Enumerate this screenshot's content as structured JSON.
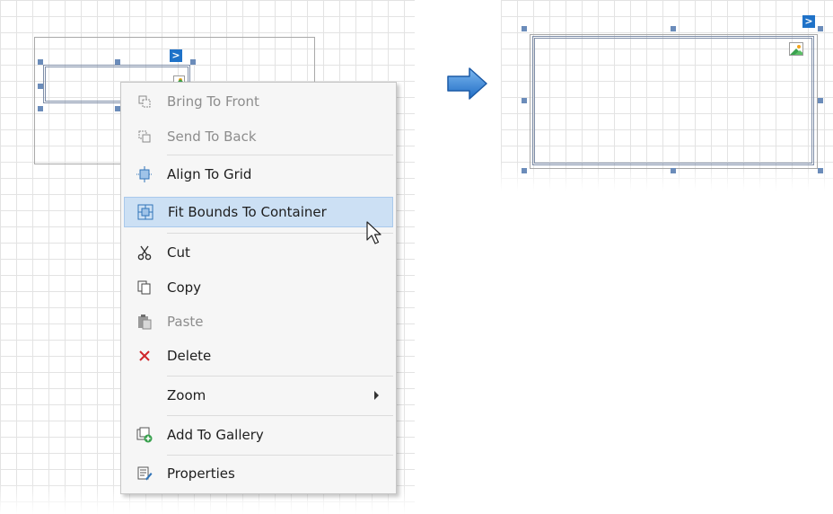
{
  "context_menu": {
    "items": [
      {
        "label": "Bring To Front",
        "icon": "bring-to-front-icon",
        "enabled": false
      },
      {
        "label": "Send To Back",
        "icon": "send-to-back-icon",
        "enabled": false
      },
      {
        "label": "Align To Grid",
        "icon": "align-to-grid-icon",
        "enabled": true
      },
      {
        "label": "Fit Bounds To Container",
        "icon": "fit-bounds-icon",
        "enabled": true,
        "highlighted": true
      },
      {
        "label": "Cut",
        "icon": "scissors-icon",
        "enabled": true
      },
      {
        "label": "Copy",
        "icon": "copy-icon",
        "enabled": true
      },
      {
        "label": "Paste",
        "icon": "paste-icon",
        "enabled": false
      },
      {
        "label": "Delete",
        "icon": "delete-icon",
        "enabled": true
      },
      {
        "label": "Zoom",
        "icon": "",
        "enabled": true,
        "has_submenu": true
      },
      {
        "label": "Add To Gallery",
        "icon": "add-to-gallery-icon",
        "enabled": true
      },
      {
        "label": "Properties",
        "icon": "properties-icon",
        "enabled": true
      }
    ]
  },
  "smart_tag_glyph": ">",
  "colors": {
    "highlight_bg": "#cce0f4",
    "arrow_blue": "#2f7fd6",
    "handle": "#6b8cba",
    "delete_red": "#d0262b",
    "smart_tag": "#1f72c8"
  }
}
